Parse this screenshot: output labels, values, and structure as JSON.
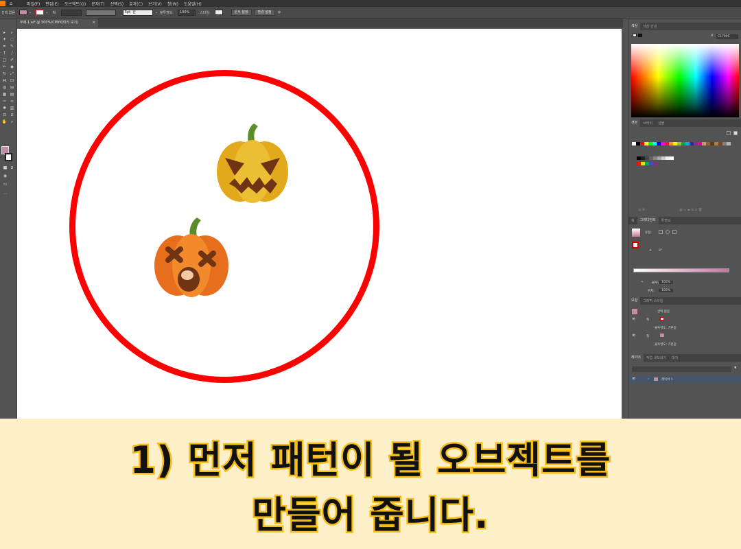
{
  "menubar": {
    "items": [
      "파일(F)",
      "편집(E)",
      "오브젝트(O)",
      "문자(T)",
      "선택(S)",
      "효과(C)",
      "보기(V)",
      "창(W)",
      "도움말(H)"
    ]
  },
  "controlbar": {
    "selection_label": "선택 없음",
    "stroke_label": "획:",
    "brush_value": "5pt. 원",
    "opacity_label": "불투명도:",
    "opacity_value": "100%",
    "style_label": "스타일:",
    "doc_setup": "문서 설정",
    "preferences": "환경 설정"
  },
  "document": {
    "tab_title": "무제-1.ai* @ 300%(CMYK/미리 보기)",
    "close": "×"
  },
  "panels": {
    "color_tabs": [
      "색상",
      "색상 안내"
    ],
    "hex_value": "C1799C",
    "swatch_tabs": [
      "견본",
      "브러쉬",
      "심볼"
    ],
    "gradient_tabs": [
      "획",
      "그라디언트",
      "투명도"
    ],
    "gradient_type_label": "유형:",
    "gradient_angle": "0°",
    "opacity_label": "불투명도:",
    "opacity_value": "100%",
    "location_label": "위치:",
    "location_value": "100%",
    "appearance_tabs": [
      "모양",
      "그래픽 스타일"
    ],
    "appearance_rows": [
      "선택 없음",
      "획",
      "불투명도: 기본값",
      "칠",
      "불투명도: 기본값"
    ],
    "layer_tabs": [
      "레이어",
      "작업 내보내기",
      "대지"
    ],
    "layer_name": "레이어 1"
  },
  "caption": {
    "line1": "1) 먼저 패턴이 될 오브젝트를",
    "line2": "만들어 줍니다."
  },
  "colors": {
    "ring": "#ff0000",
    "caption_bg": "#fdefc8",
    "caption_stroke": "#f6bd16",
    "pumpkin_yellow": "#e8b22b",
    "pumpkin_orange": "#f07c22"
  }
}
